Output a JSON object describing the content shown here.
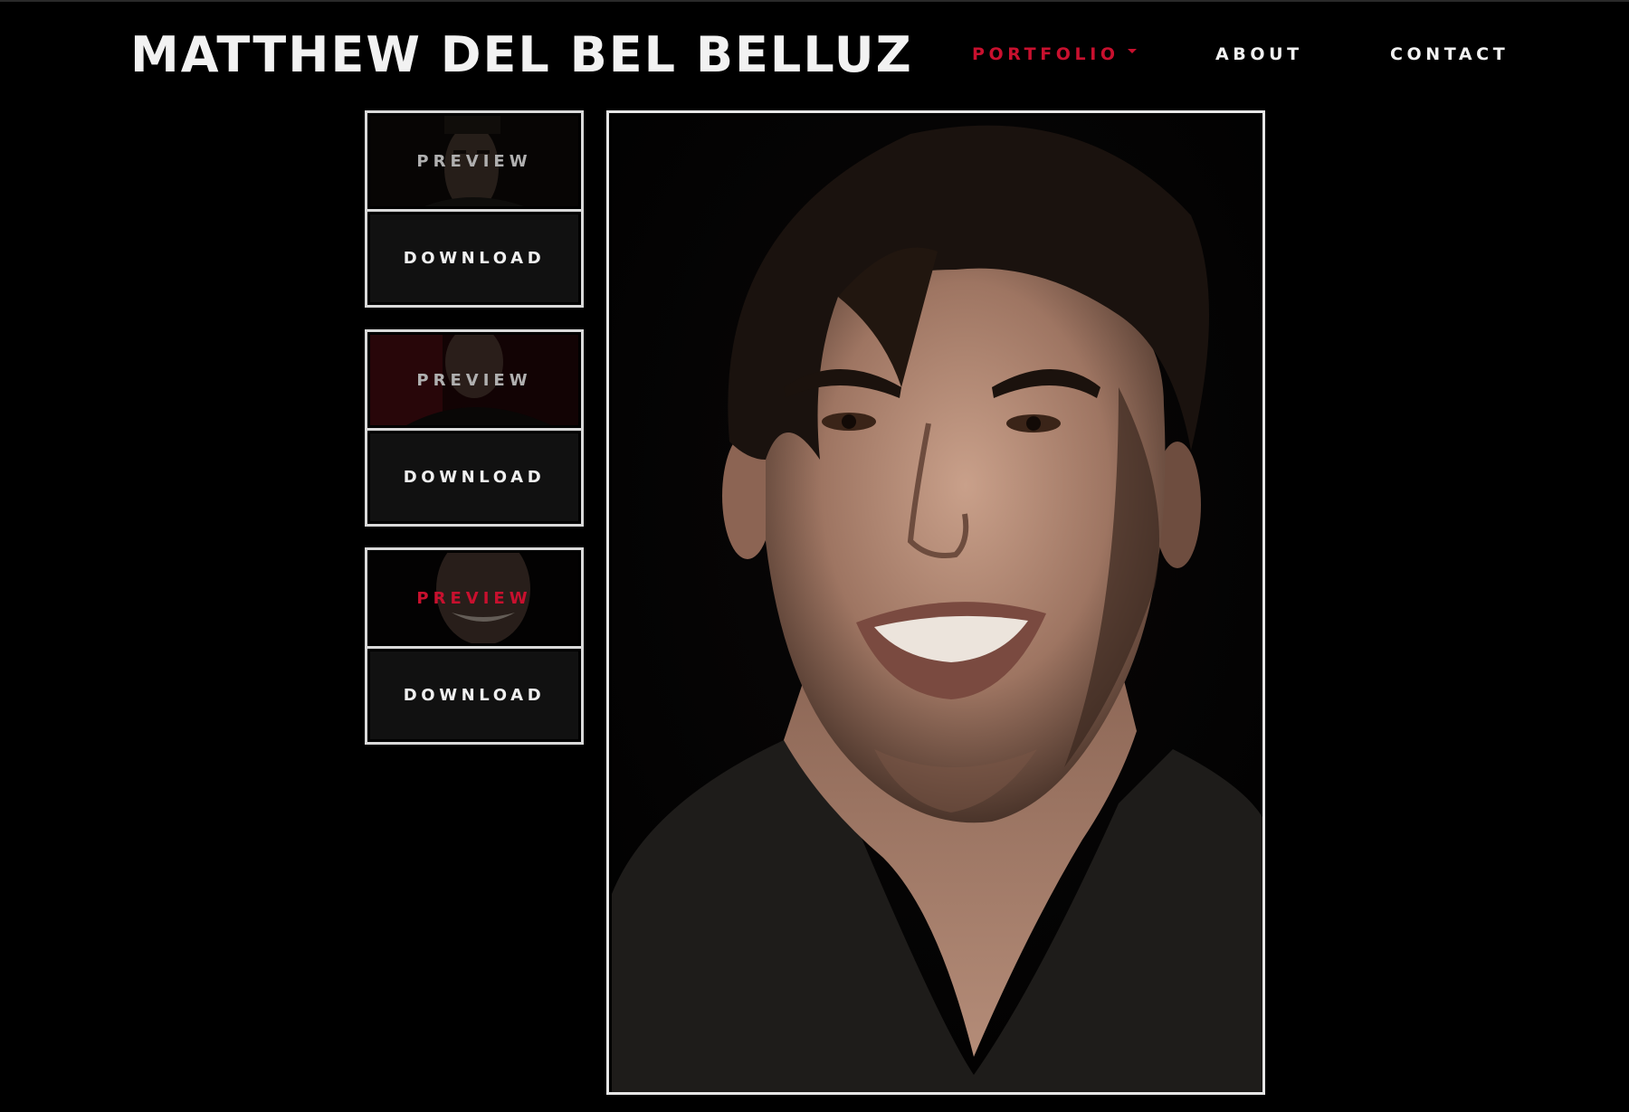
{
  "header": {
    "site_title": "MATTHEW DEL BEL BELLUZ",
    "nav": {
      "portfolio": "PORTFOLIO",
      "about": "ABOUT",
      "contact": "CONTACT"
    }
  },
  "gallery": {
    "cards": [
      {
        "preview_label": "PREVIEW",
        "download_label": "DOWNLOAD"
      },
      {
        "preview_label": "PREVIEW",
        "download_label": "DOWNLOAD"
      },
      {
        "preview_label": "PREVIEW",
        "download_label": "DOWNLOAD"
      }
    ],
    "active_index": 2
  },
  "colors": {
    "background": "#000000",
    "accent": "#c8102e",
    "text": "#f2f2f2",
    "border": "#d9d9d9"
  }
}
